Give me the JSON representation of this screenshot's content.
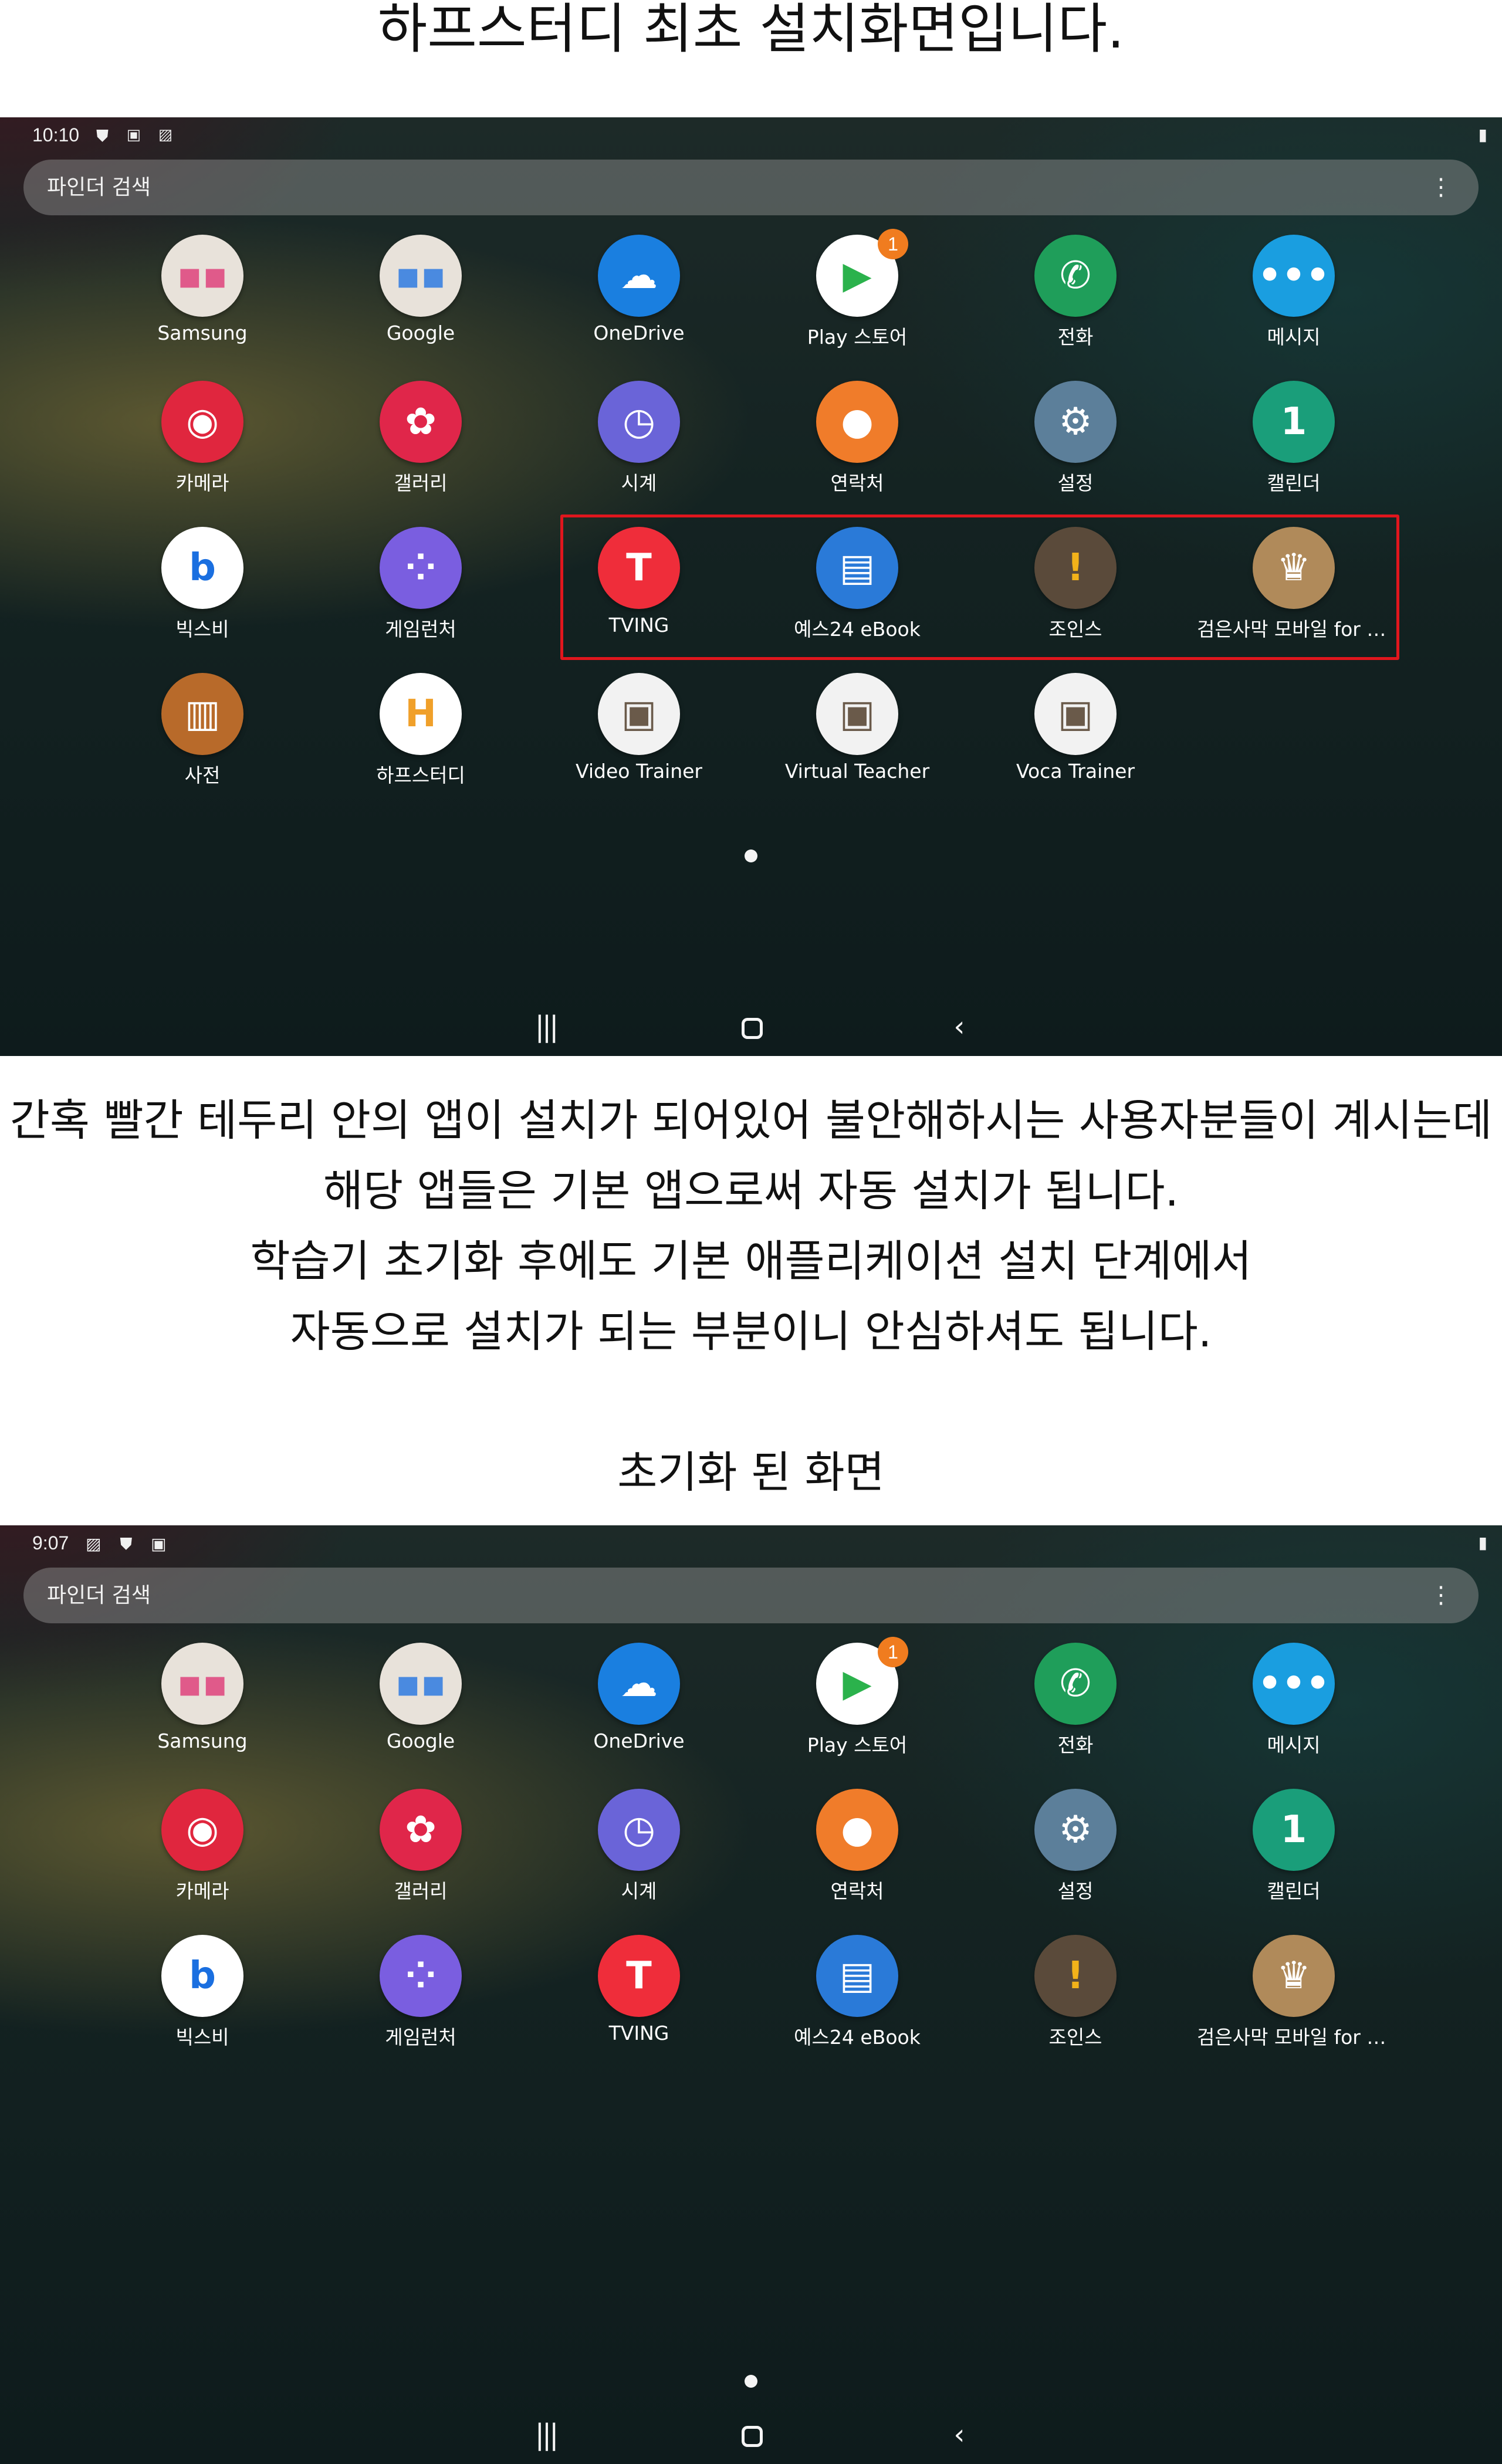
{
  "captions": {
    "top": "하프스터디 최초 설치화면입니다.",
    "middle": [
      "간혹 빨간 테두리 안의 앱이 설치가 되어있어 불안해하시는 사용자분들이 계시는데",
      "해당 앱들은 기본 앱으로써 자동 설치가 됩니다.",
      "학습기 초기화 후에도 기본 애플리케이션 설치 단계에서",
      "자동으로 설치가 되는 부분이니 안심하셔도 됩니다."
    ],
    "bottom": "초기화 된 화면"
  },
  "screen1": {
    "status": {
      "time": "10:10",
      "icons": "⛊ ▣ ▨",
      "battery": "▮"
    },
    "search": {
      "placeholder": "파인더 검색",
      "more": "⋮"
    },
    "apps": [
      {
        "label": "Samsung",
        "icon": "folder-samsung-icon",
        "color": "#e8e2da"
      },
      {
        "label": "Google",
        "icon": "folder-google-icon",
        "color": "#e8e2da"
      },
      {
        "label": "OneDrive",
        "icon": "onedrive-icon",
        "color": "#1a7fe0"
      },
      {
        "label": "Play 스토어",
        "icon": "play-store-icon",
        "color": "#ffffff",
        "badge": "1"
      },
      {
        "label": "전화",
        "icon": "phone-icon",
        "color": "#1f9e5a"
      },
      {
        "label": "메시지",
        "icon": "messages-icon",
        "color": "#1a9ee0"
      },
      {
        "label": "카메라",
        "icon": "camera-icon",
        "color": "#e0263e"
      },
      {
        "label": "갤러리",
        "icon": "gallery-icon",
        "color": "#e0264a"
      },
      {
        "label": "시계",
        "icon": "clock-icon",
        "color": "#6a64d8"
      },
      {
        "label": "연락처",
        "icon": "contacts-icon",
        "color": "#f07c2a"
      },
      {
        "label": "설정",
        "icon": "settings-icon",
        "color": "#5c7f9a"
      },
      {
        "label": "캘린더",
        "icon": "calendar-icon",
        "color": "#1a9e7a"
      },
      {
        "label": "빅스비",
        "icon": "bixby-icon",
        "color": "#ffffff"
      },
      {
        "label": "게임런처",
        "icon": "game-launcher-icon",
        "color": "#7a5ee0"
      },
      {
        "label": "TVING",
        "icon": "tving-icon",
        "color": "#ef2d3a"
      },
      {
        "label": "예스24 eBook",
        "icon": "yes24-ebook-icon",
        "color": "#2a7ad8"
      },
      {
        "label": "조인스",
        "icon": "joins-icon",
        "color": "#5a4a3a"
      },
      {
        "label": "검은사막 모바일 for S...",
        "icon": "black-desert-icon",
        "color": "#b08a5a"
      },
      {
        "label": "사전",
        "icon": "dictionary-icon",
        "color": "#b86a2a"
      },
      {
        "label": "하프스터디",
        "icon": "halfstudy-icon",
        "color": "#ffffff"
      },
      {
        "label": "Video Trainer",
        "icon": "video-trainer-icon",
        "color": "#f2f2f2"
      },
      {
        "label": "Virtual Teacher",
        "icon": "virtual-teacher-icon",
        "color": "#f2f2f2"
      },
      {
        "label": "Voca Trainer",
        "icon": "voca-trainer-icon",
        "color": "#f2f2f2"
      }
    ],
    "nav": {
      "recent": "|||",
      "back": "‹"
    }
  },
  "screen2": {
    "status": {
      "time": "9:07",
      "icons": "▨ ⛊ ▣",
      "battery": "▮"
    },
    "search": {
      "placeholder": "파인더 검색",
      "more": "⋮"
    },
    "apps": [
      {
        "label": "Samsung",
        "icon": "folder-samsung-icon",
        "color": "#e8e2da"
      },
      {
        "label": "Google",
        "icon": "folder-google-icon",
        "color": "#e8e2da"
      },
      {
        "label": "OneDrive",
        "icon": "onedrive-icon",
        "color": "#1a7fe0"
      },
      {
        "label": "Play 스토어",
        "icon": "play-store-icon",
        "color": "#ffffff",
        "badge": "1"
      },
      {
        "label": "전화",
        "icon": "phone-icon",
        "color": "#1f9e5a"
      },
      {
        "label": "메시지",
        "icon": "messages-icon",
        "color": "#1a9ee0"
      },
      {
        "label": "카메라",
        "icon": "camera-icon",
        "color": "#e0263e"
      },
      {
        "label": "갤러리",
        "icon": "gallery-icon",
        "color": "#e0264a"
      },
      {
        "label": "시계",
        "icon": "clock-icon",
        "color": "#6a64d8"
      },
      {
        "label": "연락처",
        "icon": "contacts-icon",
        "color": "#f07c2a"
      },
      {
        "label": "설정",
        "icon": "settings-icon",
        "color": "#5c7f9a"
      },
      {
        "label": "캘린더",
        "icon": "calendar-icon",
        "color": "#1a9e7a"
      },
      {
        "label": "빅스비",
        "icon": "bixby-icon",
        "color": "#ffffff"
      },
      {
        "label": "게임런처",
        "icon": "game-launcher-icon",
        "color": "#7a5ee0"
      },
      {
        "label": "TVING",
        "icon": "tving-icon",
        "color": "#ef2d3a"
      },
      {
        "label": "예스24 eBook",
        "icon": "yes24-ebook-icon",
        "color": "#2a7ad8"
      },
      {
        "label": "조인스",
        "icon": "joins-icon",
        "color": "#5a4a3a"
      },
      {
        "label": "검은사막 모바일 for S...",
        "icon": "black-desert-icon",
        "color": "#b08a5a"
      }
    ],
    "nav": {
      "recent": "|||",
      "back": "‹"
    }
  },
  "highlight_color": "#e0161d"
}
